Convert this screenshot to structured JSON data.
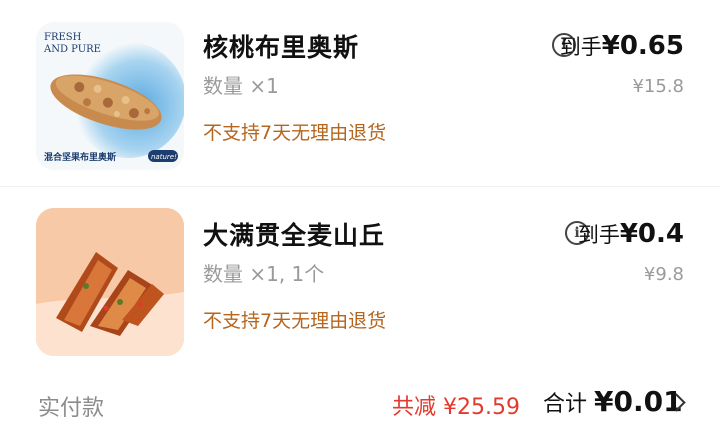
{
  "items": [
    {
      "title": "核桃布里奥斯",
      "quantity": "数量 ×1",
      "policy": "不支持7天无理由退货",
      "net_label": "到手",
      "net_price": "¥0.65",
      "original_price": "¥15.8",
      "image": {
        "tagline": "FRESH\nAND PURE",
        "caption": "混合坚果布里奥斯",
        "badge": "nature!"
      }
    },
    {
      "title": "大满贯全麦山丘",
      "quantity": "数量 ×1, 1个",
      "policy": "不支持7天无理由退货",
      "net_label": "到手",
      "net_price": "¥0.4",
      "original_price": "¥9.8"
    }
  ],
  "footer": {
    "paid_label": "实付款",
    "discount": "共减 ¥25.59",
    "total_label": "合计",
    "total_amount": "¥0.01"
  },
  "colors": {
    "policy": "#b5651d",
    "discount": "#e23a2e",
    "muted": "#9a9a9a"
  },
  "icons": [
    "info-icon",
    "chevron-right-icon"
  ]
}
